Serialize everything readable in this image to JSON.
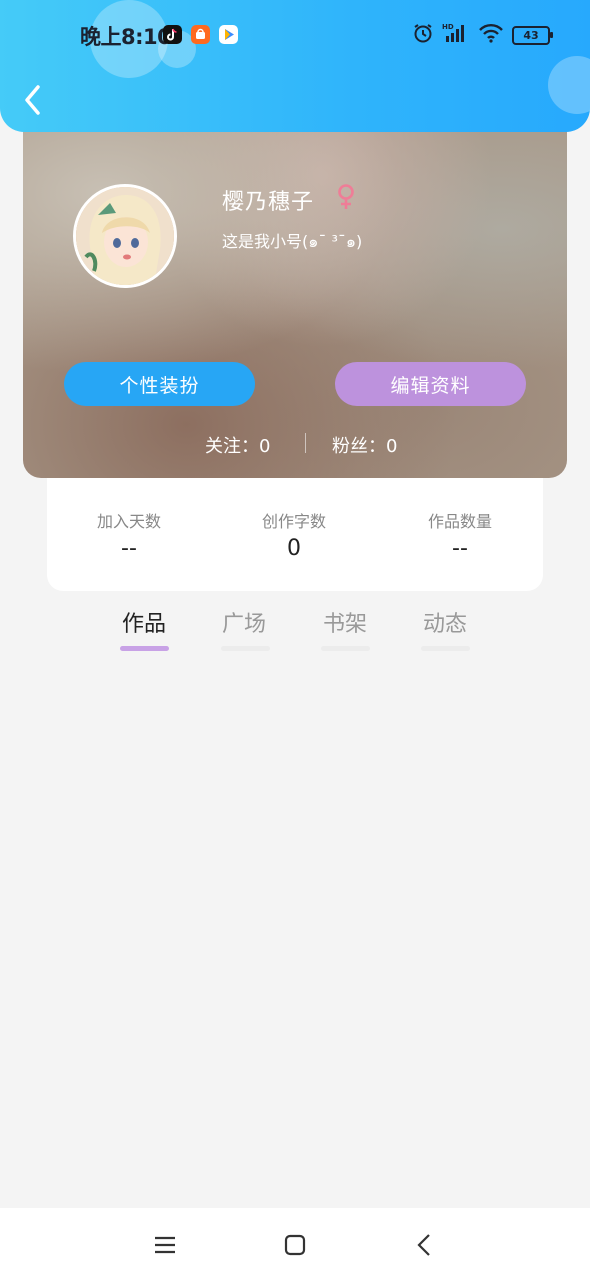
{
  "status_bar": {
    "time": "晚上8:10",
    "battery": "43",
    "icons": [
      "tiktok-icon",
      "taobao-icon",
      "video-player-icon",
      "alarm-icon",
      "signal-hd-icon",
      "wifi-icon",
      "battery-icon"
    ]
  },
  "header": {
    "back_icon": "chevron-left-icon",
    "colors": {
      "gradient_start": "#45cbf8",
      "gradient_end": "#27a9fd"
    }
  },
  "profile": {
    "nickname": "樱乃穗子",
    "gender_icon": "female-icon",
    "gender_color": "#ef7d97",
    "bio": "这是我小号(๑¯ ³¯๑)",
    "buttons": {
      "dress_up": "个性装扮",
      "edit_profile": "编辑资料"
    },
    "button_colors": {
      "dress_up": "#27a6f5",
      "edit_profile": "#bd92dd"
    },
    "follow_label": "关注：0",
    "fans_label": "粉丝：0"
  },
  "stats": [
    {
      "label": "加入天数",
      "value": "--"
    },
    {
      "label": "创作字数",
      "value": "0"
    },
    {
      "label": "作品数量",
      "value": "--"
    }
  ],
  "tabs": {
    "items": [
      {
        "label": "作品",
        "active": true
      },
      {
        "label": "广场",
        "active": false
      },
      {
        "label": "书架",
        "active": false
      },
      {
        "label": "动态",
        "active": false
      }
    ],
    "active_color": "#c8a2e6"
  },
  "nav_bar": {
    "icons": [
      "menu-icon",
      "home-icon",
      "back-icon"
    ]
  }
}
